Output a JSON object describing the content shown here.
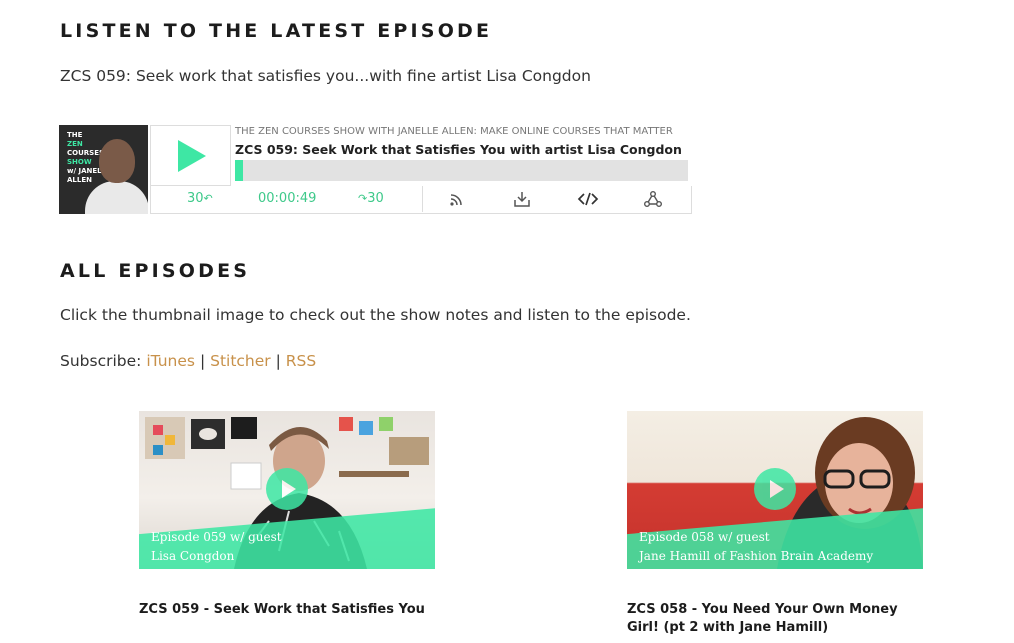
{
  "latest": {
    "heading": "LISTEN TO THE LATEST EPISODE",
    "subtitle": "ZCS 059: Seek work that satisfies you...with fine artist Lisa Congdon"
  },
  "player": {
    "cover_text": [
      "THE",
      "ZEN",
      "COURSES",
      "SHOW",
      "w/ JANELLE",
      "ALLEN"
    ],
    "show_title": "THE ZEN COURSES SHOW WITH JANELLE ALLEN: MAKE ONLINE COURSES THAT MATTER",
    "episode_title": "ZCS 059: Seek Work that Satisfies You with artist Lisa Congdon",
    "progress": 0.017,
    "rewind_label": "30",
    "time": "00:00:49",
    "forward_label": "30",
    "icons": [
      "rss-icon",
      "download-icon",
      "embed-icon",
      "share-icon"
    ]
  },
  "all": {
    "heading": "ALL EPISODES",
    "intro": "Click the thumbnail image to check out the show notes and listen to the episode.",
    "subscribe_label": "Subscribe:",
    "links": [
      "iTunes",
      "Stitcher",
      "RSS"
    ],
    "separator": "|"
  },
  "episodes": [
    {
      "caption_line1": "Episode 059 w/ guest",
      "caption_line2": "Lisa Congdon",
      "title": "ZCS 059 - Seek Work that Satisfies You"
    },
    {
      "caption_line1": "Episode 058 w/ guest",
      "caption_line2": "Jane Hamill of Fashion Brain Academy",
      "title": "ZCS 058 - You Need Your Own Money Girl! (pt 2 with Jane Hamill)"
    }
  ],
  "colors": {
    "accent": "#3ee7a4",
    "link": "#c8914a",
    "heading": "#1c1c1c"
  }
}
